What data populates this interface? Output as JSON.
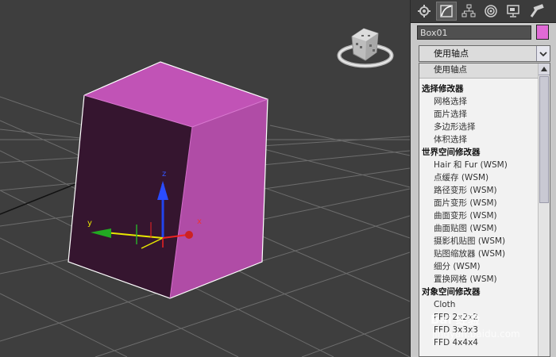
{
  "object": {
    "name": "Box01",
    "color": "#e06ad6"
  },
  "toolbar": {
    "tabs": [
      "create-icon",
      "modify-icon",
      "hierarchy-icon",
      "motion-icon",
      "display-icon",
      "utilities-icon"
    ]
  },
  "gizmo": {
    "x_label": "x",
    "y_label": "y",
    "z_label": "z"
  },
  "modifier_dropdown": {
    "value": "使用轴点"
  },
  "modifier_list": {
    "selected": "使用轴点",
    "groups": [
      {
        "title": "选择修改器",
        "items": [
          "网格选择",
          "面片选择",
          "多边形选择",
          "体积选择"
        ]
      },
      {
        "title": "世界空间修改器",
        "items": [
          "Hair 和 Fur (WSM)",
          "点缓存 (WSM)",
          "路径变形 (WSM)",
          "面片变形 (WSM)",
          "曲面变形 (WSM)",
          "曲面贴图 (WSM)",
          "摄影机贴图 (WSM)",
          "贴图缩放器 (WSM)",
          "细分 (WSM)",
          "置换网格 (WSM)"
        ]
      },
      {
        "title": "对象空间修改器",
        "items": [
          "Cloth",
          "FFD 2x2x2",
          "FFD 3x3x3",
          "FFD 4x4x4"
        ]
      }
    ]
  },
  "watermark": {
    "brand": "Bai 经验",
    "url": "jingyan.baidu.com"
  }
}
